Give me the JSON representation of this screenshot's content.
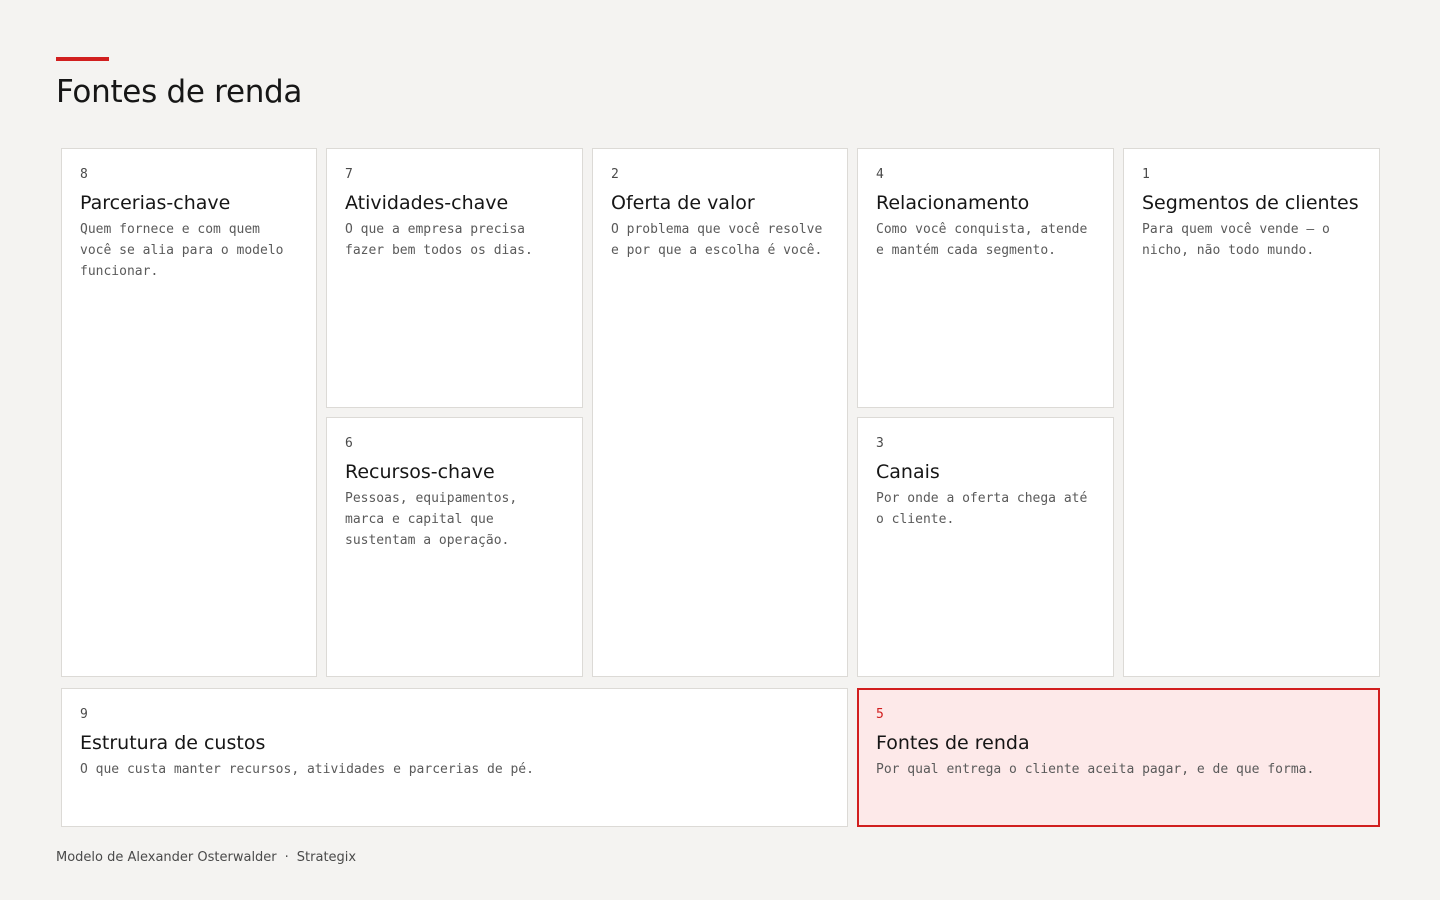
{
  "page_title": "Fontes de renda",
  "accent_color": "#d11f1f",
  "blocks": {
    "b8": {
      "number": "8",
      "title": "Parcerias-chave",
      "description": "Quem fornece e com quem você se alia para o modelo funcionar."
    },
    "b7": {
      "number": "7",
      "title": "Atividades-chave",
      "description": "O que a empresa precisa fazer bem todos os dias."
    },
    "b6": {
      "number": "6",
      "title": "Recursos-chave",
      "description": "Pessoas, equipamentos, marca e capital que sustentam a operação."
    },
    "b2": {
      "number": "2",
      "title": "Oferta de valor",
      "description": "O problema que você resolve e por que a escolha é você."
    },
    "b4": {
      "number": "4",
      "title": "Relacionamento",
      "description": "Como você conquista, atende e mantém cada segmento."
    },
    "b3": {
      "number": "3",
      "title": "Canais",
      "description": "Por onde a oferta chega até o cliente."
    },
    "b1": {
      "number": "1",
      "title": "Segmentos de clientes",
      "description": "Para quem você vende — o nicho, não todo mundo."
    },
    "b9": {
      "number": "9",
      "title": "Estrutura de custos",
      "description": "O que custa manter recursos, atividades e parcerias de pé."
    },
    "b5": {
      "number": "5",
      "title": "Fontes de renda",
      "description": "Por qual entrega o cliente aceita pagar, e de que forma."
    }
  },
  "active_block": "5",
  "footer": {
    "credit": "Modelo de Alexander Osterwalder",
    "separator": "·",
    "brand": "Strategix"
  }
}
